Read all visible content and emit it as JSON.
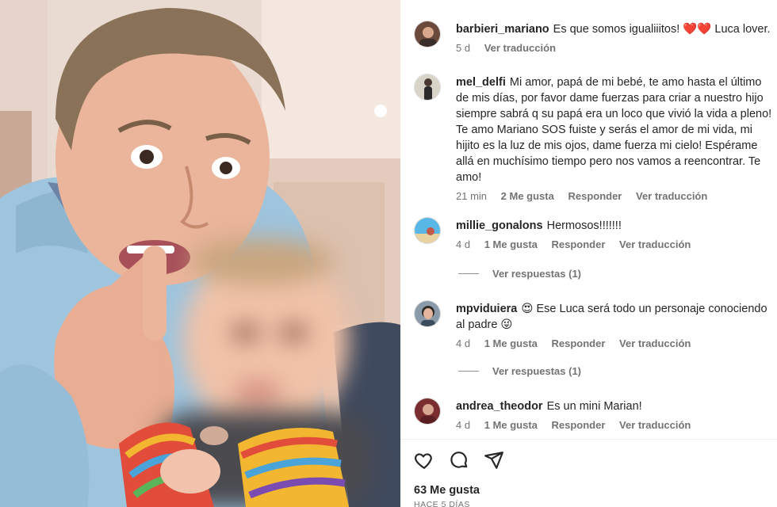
{
  "comments": [
    {
      "username": "barbieri_mariano",
      "text": "Es que somos igualiiitos! ❤️❤️ Luca lover.",
      "time": "5 d",
      "likes": "",
      "reply": "",
      "translate": "Ver traducción"
    },
    {
      "username": "mel_delfi",
      "text": "Mi amor, papá de mi bebé, te amo hasta el último de mis días, por favor dame fuerzas para criar a nuestro hijo siempre sabrá q su papá era un loco que vivió la vida a pleno! Te amo Mariano SOS fuiste y serás el amor de mi vida, mi hijito es la luz de mis ojos, dame fuerza mi cielo! Espérame allá en muchísimo tiempo pero nos vamos a reencontrar. Te amo!",
      "time": "21 min",
      "likes": "2 Me gusta",
      "reply": "Responder",
      "translate": "Ver traducción"
    },
    {
      "username": "millie_gonalons",
      "text": "Hermosos!!!!!!!",
      "time": "4 d",
      "likes": "1 Me gusta",
      "reply": "Responder",
      "translate": "Ver traducción",
      "view_replies": "Ver respuestas (1)"
    },
    {
      "username": "mpviduiera",
      "text": "😍 Ese Luca será todo un personaje conociendo al padre 😜",
      "time": "4 d",
      "likes": "1 Me gusta",
      "reply": "Responder",
      "translate": "Ver traducción",
      "view_replies": "Ver respuestas (1)"
    },
    {
      "username": "andrea_theodor",
      "text": "Es un mini Marian!",
      "time": "4 d",
      "likes": "1 Me gusta",
      "reply": "Responder",
      "translate": "Ver traducción"
    }
  ],
  "footer": {
    "likes": "63 Me gusta",
    "posted": "HACE 5 DÍAS"
  },
  "icons": [
    "heart-icon",
    "comment-icon",
    "share-icon"
  ]
}
